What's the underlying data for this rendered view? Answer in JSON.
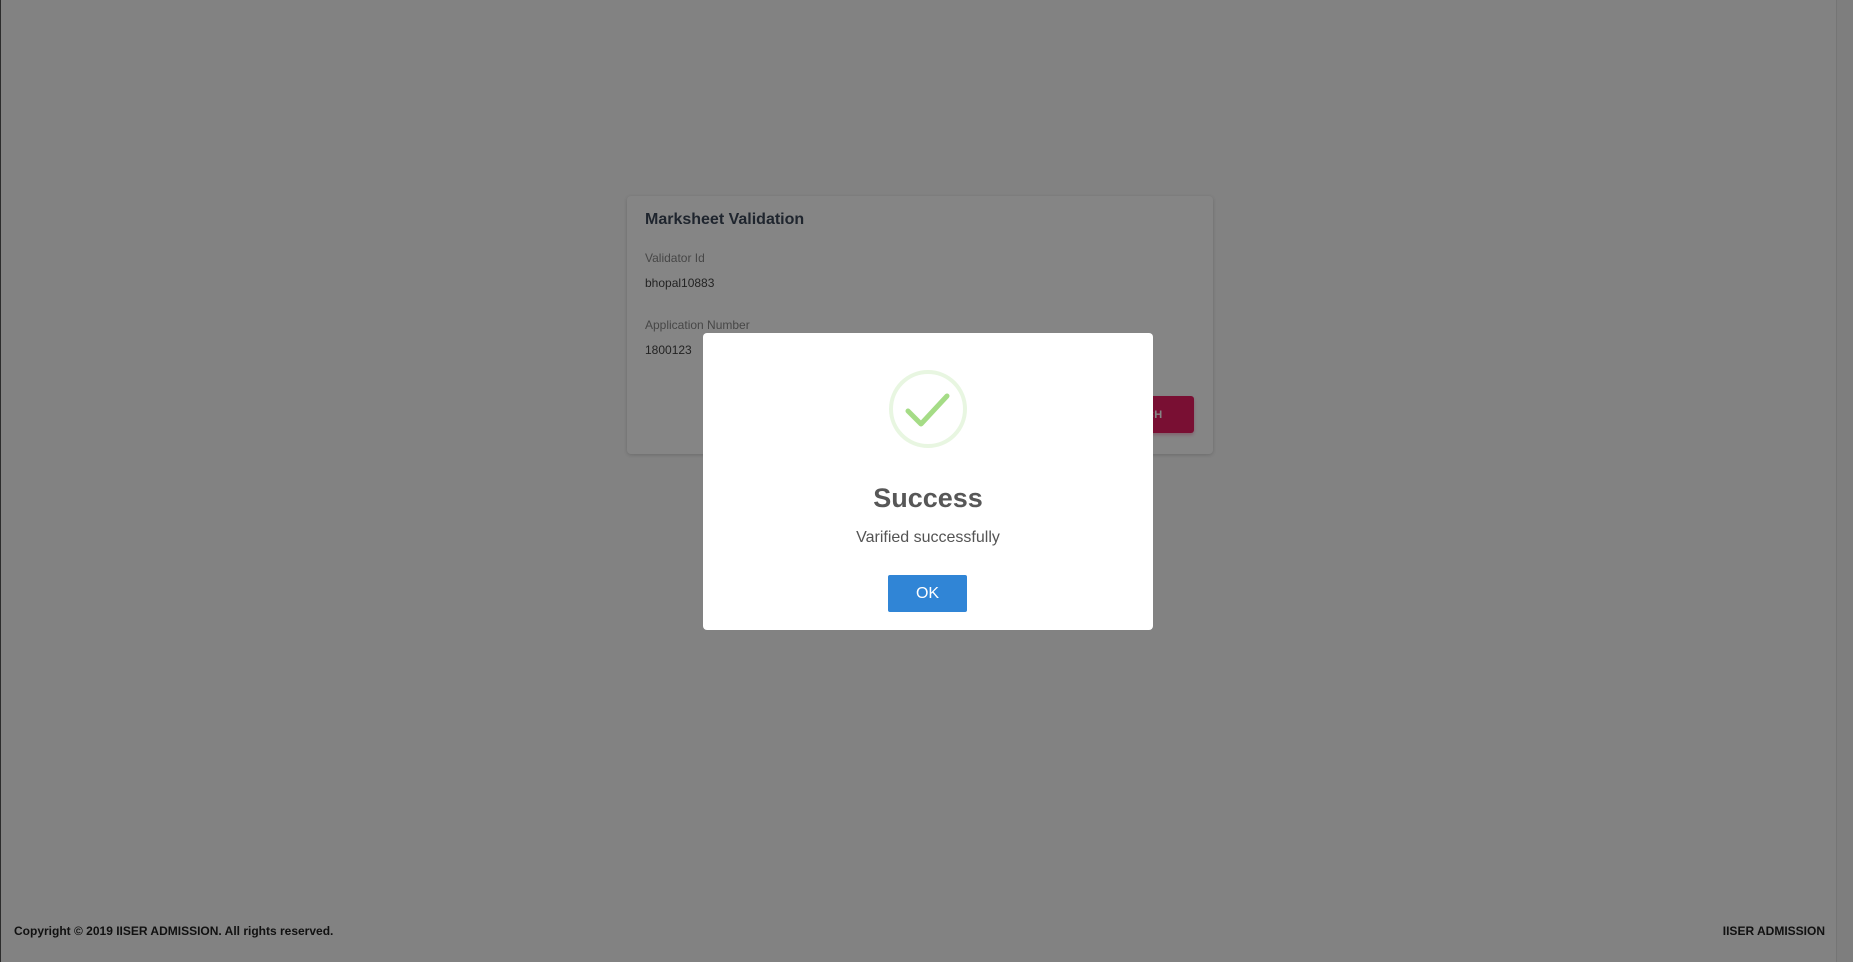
{
  "card": {
    "title": "Marksheet Validation",
    "validator_label": "Validator Id",
    "validator_value": "bhopal10883",
    "application_label": "Application Number",
    "application_value": "1800123",
    "search_label": "SEARCH"
  },
  "footer": {
    "copyright": "Copyright © 2019 IISER ADMISSION. All rights reserved.",
    "brand": "IISER ADMISSION"
  },
  "modal": {
    "icon": "success-check-icon",
    "title": "Success",
    "message": "Varified successfully",
    "ok_label": "OK"
  },
  "colors": {
    "accent": "#e91e63",
    "ok_button": "#3085d6",
    "success_check": "#a5dc86"
  }
}
